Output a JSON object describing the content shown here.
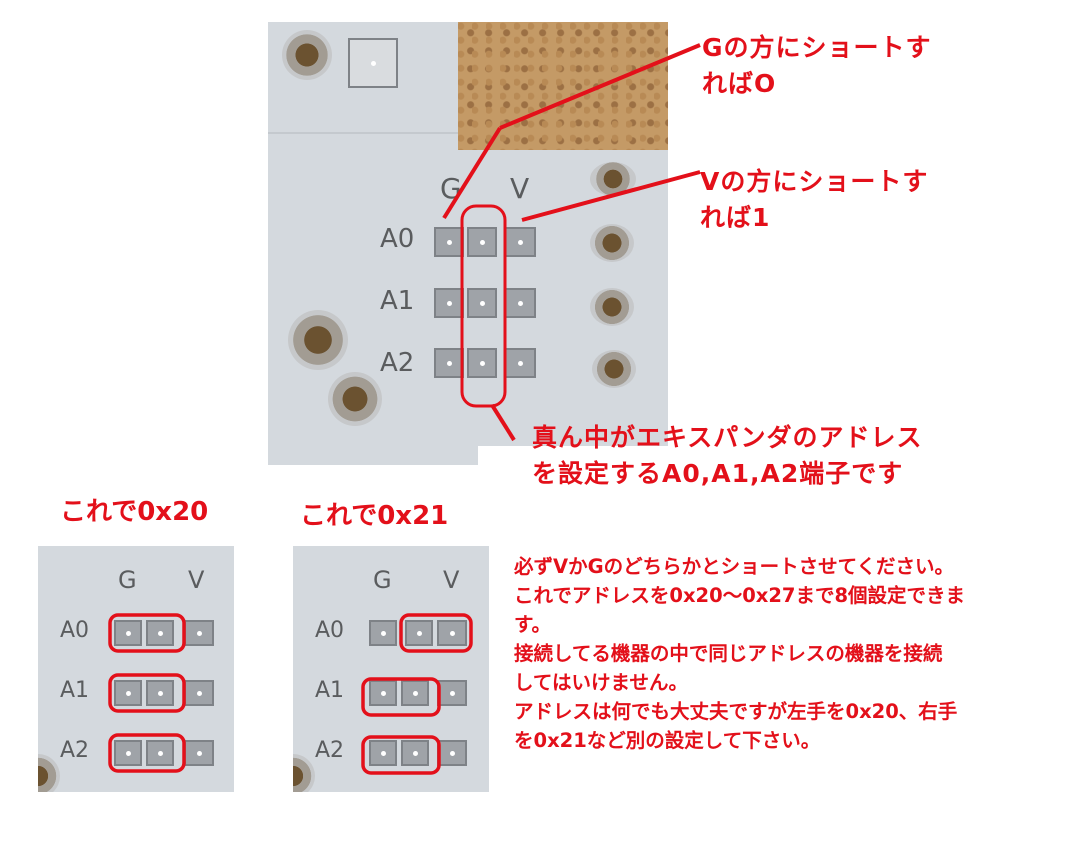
{
  "annotations": {
    "g_short": [
      "Gの方にショートす",
      "ればO"
    ],
    "v_short": [
      "Vの方にショートす",
      "れば1"
    ],
    "center_pins": [
      "真ん中がエキスパンダのアドレス",
      "を設定するA0,A1,A2端子です"
    ]
  },
  "examples": [
    {
      "caption": "これで0x20"
    },
    {
      "caption": "これで0x21"
    }
  ],
  "instructions": [
    "必ずVかGのどちらかとショートさせてください。",
    "これでアドレスを0x20～0x27まで8個設定できま",
    "す。",
    "接続してる機器の中で同じアドレスの機器を接続",
    "してはいけません。",
    "アドレスは何でも大丈夫ですが左手を0x20、右手",
    "を0x21など別の設定して下さい。"
  ],
  "board_labels": {
    "g": "G",
    "v": "V",
    "rows": [
      "A0",
      "A1",
      "A2"
    ]
  },
  "colors": {
    "annotation": "#e3101a",
    "board": "#d4d9de"
  }
}
